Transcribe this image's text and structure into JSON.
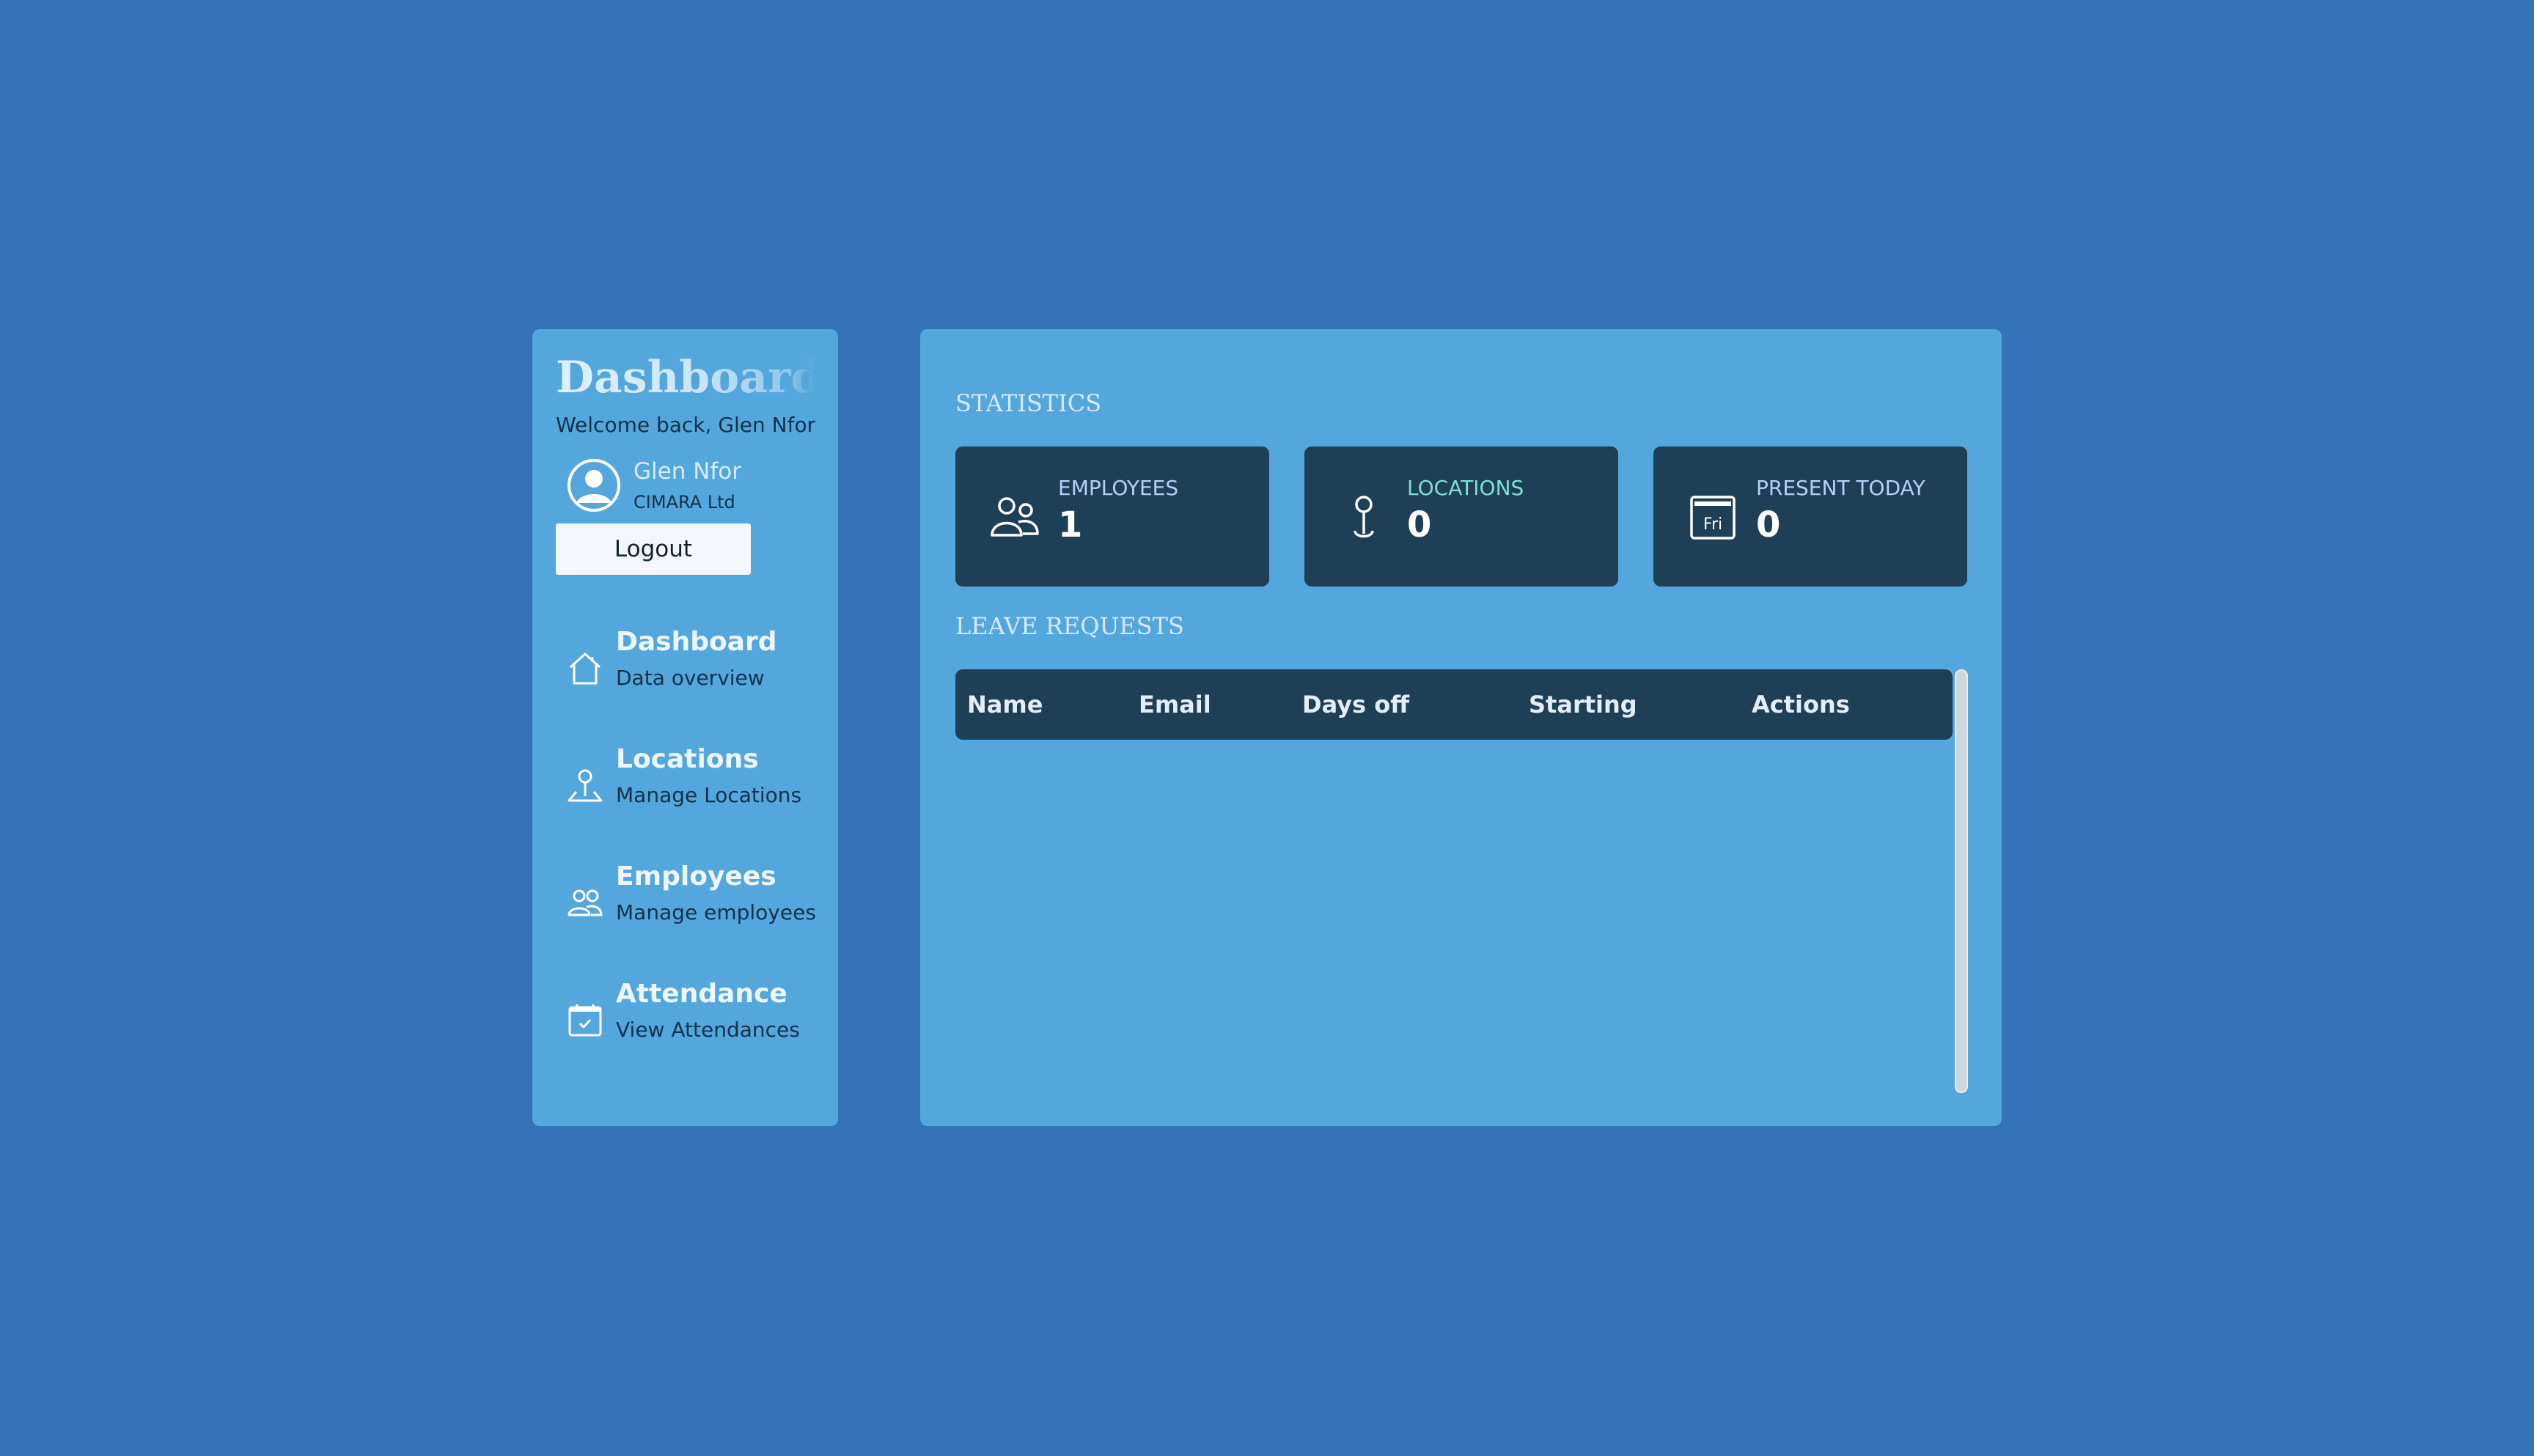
{
  "sidebar": {
    "title": "Dashboard",
    "welcome": "Welcome back, Glen Nfor",
    "user": {
      "name": "Glen Nfor",
      "company": "CIMARA Ltd"
    },
    "logout_label": "Logout",
    "nav": [
      {
        "label": "Dashboard",
        "sub": "Data overview",
        "icon": "home-icon"
      },
      {
        "label": "Locations",
        "sub": "Manage Locations",
        "icon": "map-pin-icon"
      },
      {
        "label": "Employees",
        "sub": "Manage employees",
        "icon": "users-icon"
      },
      {
        "label": "Attendance",
        "sub": "View Attendances",
        "icon": "calendar-check-icon"
      }
    ]
  },
  "main": {
    "statistics_title": "STATISTICS",
    "stats": [
      {
        "label": "EMPLOYEES",
        "value": "1",
        "icon": "users-icon",
        "label_color": "#b7cdf7"
      },
      {
        "label": "LOCATIONS",
        "value": "0",
        "icon": "map-pin-icon",
        "label_color": "#7fe0d0"
      },
      {
        "label": "PRESENT TODAY",
        "value": "0",
        "icon": "calendar-icon",
        "icon_text": "Fri",
        "label_color": "#b7cdf7"
      }
    ],
    "leave_requests_title": "LEAVE REQUESTS",
    "table": {
      "columns": [
        "Name",
        "Email",
        "Days off",
        "Starting",
        "Actions"
      ],
      "rows": []
    }
  },
  "colors": {
    "background": "#3473b8",
    "panel": "#53a7dd",
    "card": "#1f3f56"
  }
}
